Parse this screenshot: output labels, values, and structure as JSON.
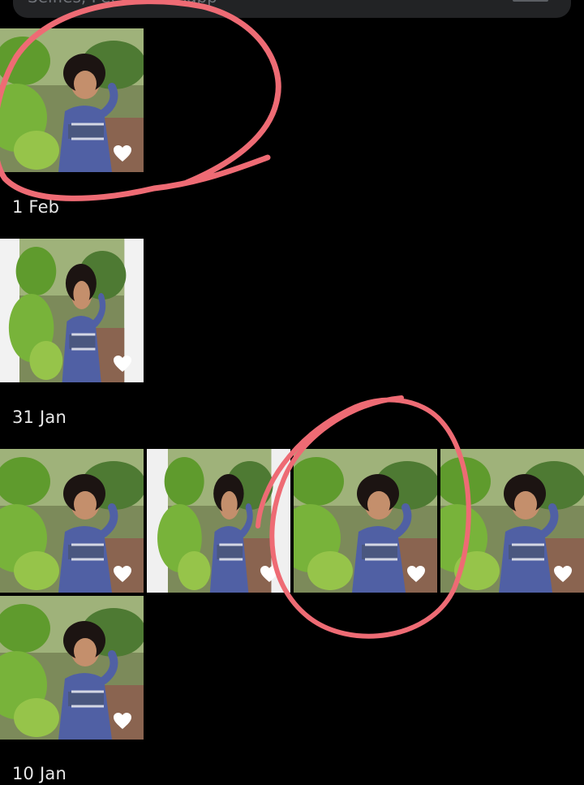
{
  "search": {
    "placeholder": "Selfies, Pets, Whatsapp"
  },
  "groups": [
    {
      "label": "1 Feb",
      "photos": [
        {
          "favourite": true
        }
      ]
    },
    {
      "label": "",
      "photos": [
        {
          "favourite": true
        }
      ]
    },
    {
      "label": "31 Jan",
      "photos": [
        {
          "favourite": true
        },
        {
          "favourite": true
        },
        {
          "favourite": true
        },
        {
          "favourite": true
        },
        {
          "favourite": true
        }
      ]
    },
    {
      "label": "10 Jan",
      "photos": []
    }
  ],
  "icons": {
    "favourite": "heart-icon"
  },
  "colors": {
    "background": "#000000",
    "annotation": "#ee6b74",
    "heart": "#ffffff"
  }
}
